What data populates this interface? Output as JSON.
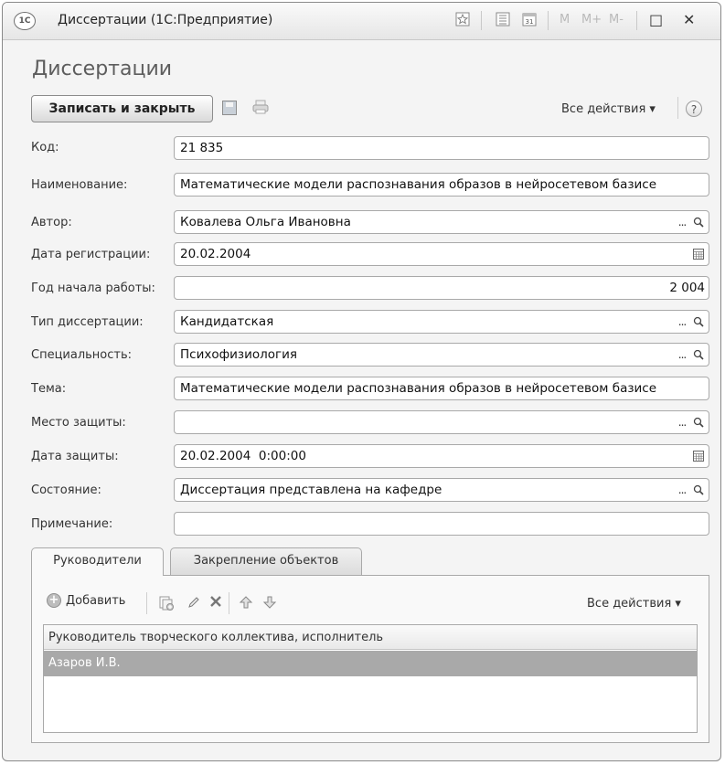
{
  "window": {
    "title": "Диссертации (1С:Предприятие)",
    "logo_text": "1С",
    "title_buttons": [
      "favorite-icon",
      "list-icon",
      "calendar-icon"
    ],
    "memory_buttons": {
      "m": "M",
      "m_plus": "M+",
      "m_minus": "M-"
    },
    "maximize_glyph": "□",
    "close_glyph": "✕"
  },
  "form": {
    "title": "Диссертации",
    "toolbar": {
      "save_close_label": "Записать и закрыть",
      "all_actions_label": "Все действия ▾",
      "help_label": "?"
    },
    "fields": [
      {
        "label": "Код:",
        "value": "21 835"
      },
      {
        "label": "Наименование:",
        "value": "Математические модели распознавания образов в нейросетевом базисе"
      },
      {
        "label": "Автор:",
        "value": "Ковалева Ольга Ивановна"
      },
      {
        "label": "Дата регистрации:",
        "value": "20.02.2004"
      },
      {
        "label": "Год начала работы:",
        "value": "2 004"
      },
      {
        "label": "Тип диссертации:",
        "value": "Кандидатская"
      },
      {
        "label": "Специальность:",
        "value": "Психофизиология"
      },
      {
        "label": "Тема:",
        "value": "Математические модели распознавания образов в нейросетевом базисе"
      },
      {
        "label": "Место защиты:",
        "value": ""
      },
      {
        "label": "Дата защиты:",
        "value": "20.02.2004  0:00:00"
      },
      {
        "label": "Состояние:",
        "value": "Диссертация представлена на кафедре"
      },
      {
        "label": "Примечание:",
        "value": ""
      }
    ],
    "choice_button_text": "...",
    "tabs": [
      {
        "label": "Руководители",
        "active": true
      },
      {
        "label": "Закрепление объектов",
        "active": false
      }
    ],
    "table_toolbar": {
      "add_label": "Добавить",
      "all_actions_label": "Все действия ▾"
    },
    "table": {
      "columns": [
        "Руководитель творческого коллектива, исполнитель"
      ],
      "rows": [
        [
          "Азаров И.В."
        ]
      ]
    }
  },
  "colors": {
    "selected_row": "#a9a9a9",
    "window_bg": "#f4f4f4",
    "field_border": "#a9a9a9"
  }
}
